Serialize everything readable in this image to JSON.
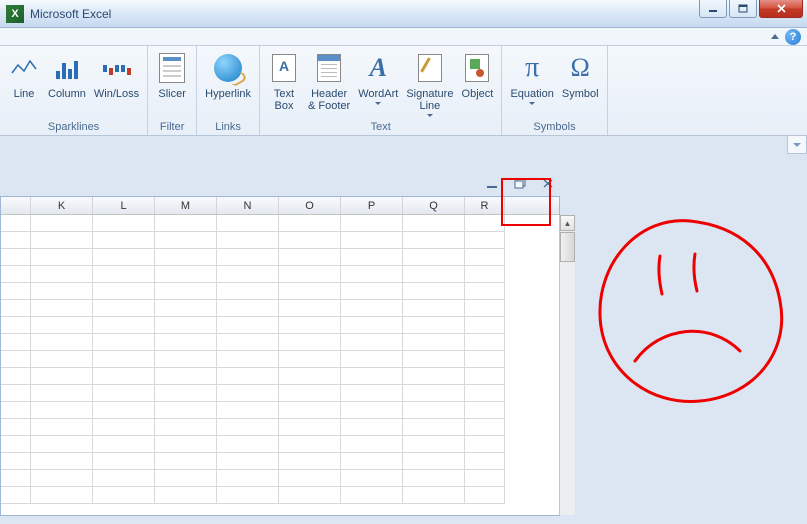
{
  "title": "Microsoft Excel",
  "ribbon": {
    "groups": [
      {
        "label": "Sparklines",
        "buttons": [
          {
            "label": "Line",
            "icon": "sparkline-line"
          },
          {
            "label": "Column",
            "icon": "sparkline-column"
          },
          {
            "label": "Win/Loss",
            "icon": "sparkline-winloss"
          }
        ]
      },
      {
        "label": "Filter",
        "buttons": [
          {
            "label": "Slicer",
            "icon": "slicer"
          }
        ]
      },
      {
        "label": "Links",
        "buttons": [
          {
            "label": "Hyperlink",
            "icon": "hyperlink"
          }
        ]
      },
      {
        "label": "Text",
        "buttons": [
          {
            "label": "Text\nBox",
            "icon": "textbox"
          },
          {
            "label": "Header\n& Footer",
            "icon": "header-footer"
          },
          {
            "label": "WordArt",
            "icon": "wordart",
            "dropdown": true
          },
          {
            "label": "Signature\nLine",
            "icon": "signature",
            "dropdown": true
          },
          {
            "label": "Object",
            "icon": "object"
          }
        ]
      },
      {
        "label": "Symbols",
        "buttons": [
          {
            "label": "Equation",
            "icon": "equation",
            "dropdown": true
          },
          {
            "label": "Symbol",
            "icon": "symbol"
          }
        ]
      }
    ]
  },
  "columns": [
    "",
    "K",
    "L",
    "M",
    "N",
    "O",
    "P",
    "Q",
    "R"
  ]
}
